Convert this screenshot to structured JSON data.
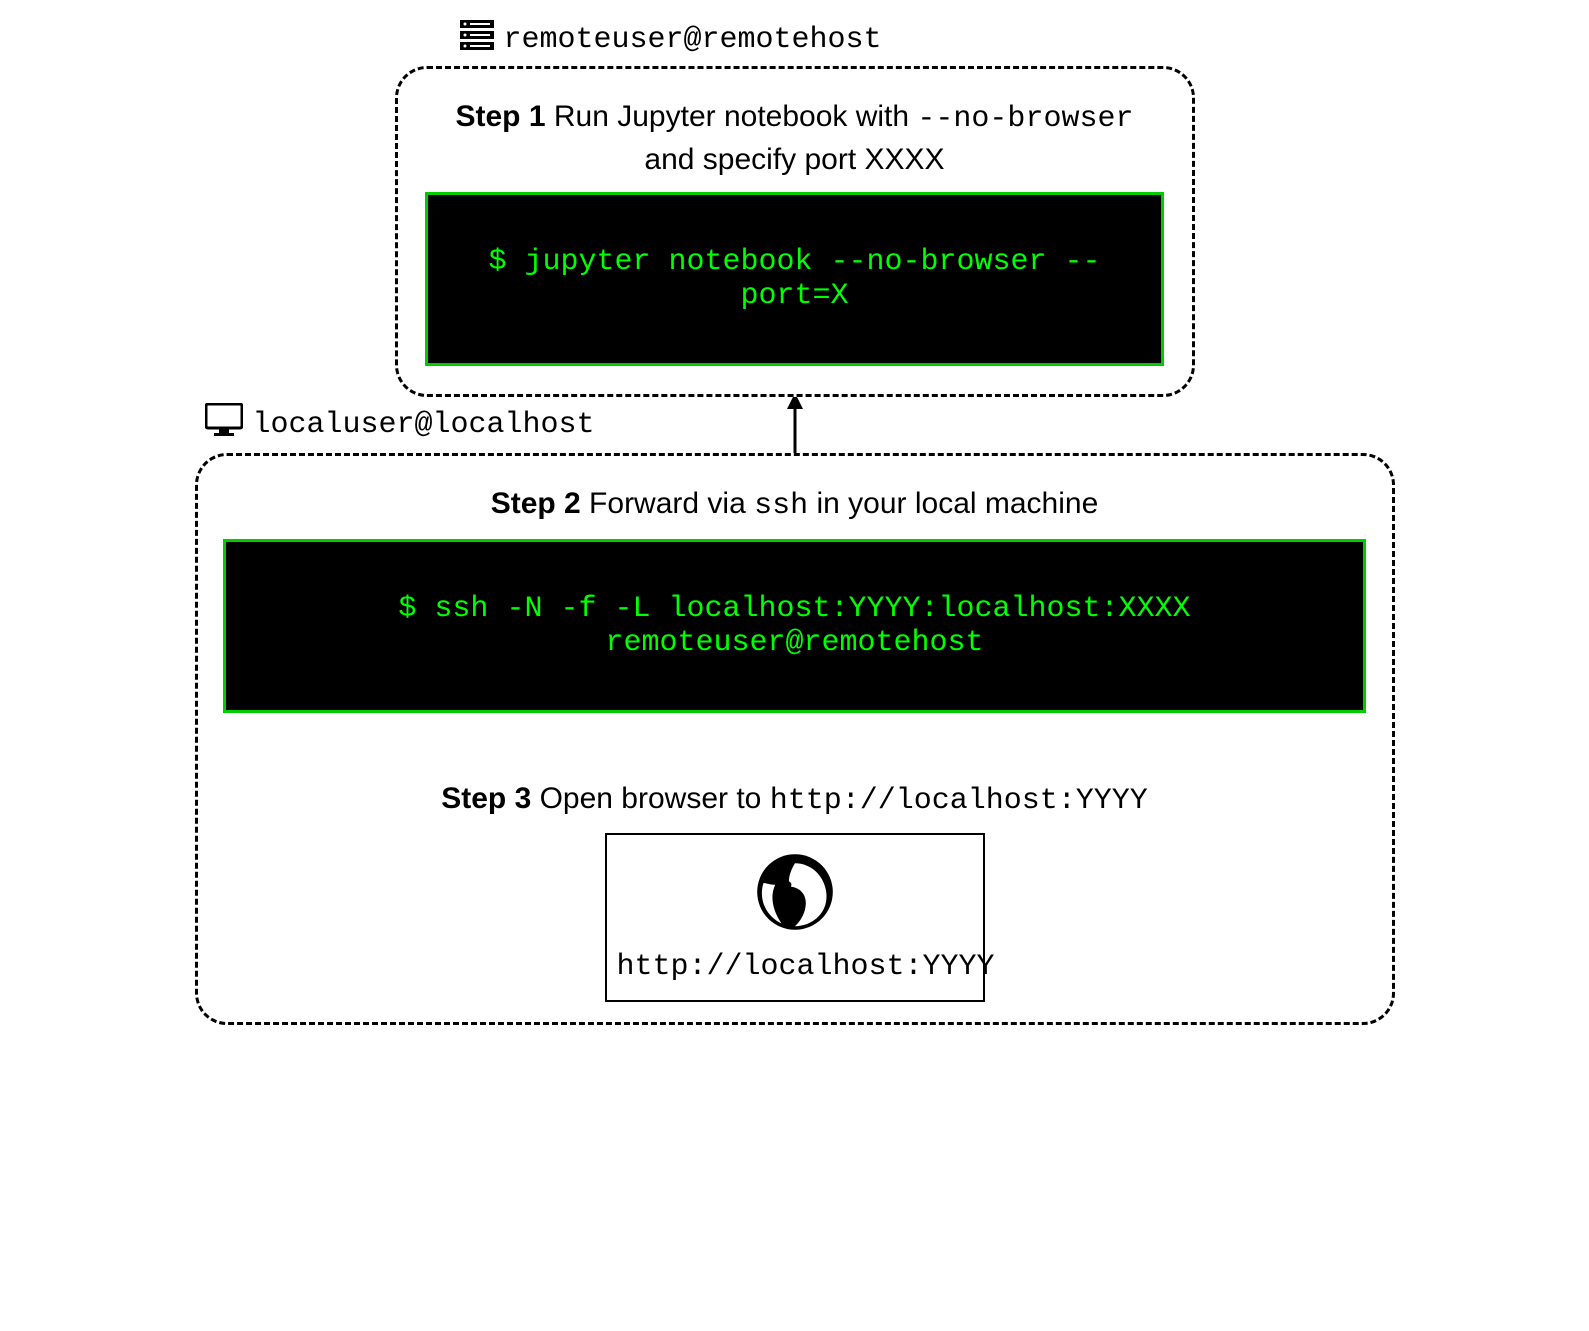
{
  "remote": {
    "host_label": "remoteuser@remotehost",
    "step1": {
      "strong": "Step 1",
      "text_before_tt": " Run Jupyter notebook with ",
      "tt": "--no-browser",
      "text_after_tt": " and specify port XXXX",
      "command": "$ jupyter notebook --no-browser --port=X"
    }
  },
  "local": {
    "host_label": "localuser@localhost",
    "step2": {
      "strong": "Step 2",
      "text_before_tt": " Forward via ",
      "tt": "ssh",
      "text_after_tt": " in your local machine",
      "command": "$ ssh -N -f -L localhost:YYYY:localhost:XXXX remoteuser@remotehost"
    },
    "step3": {
      "strong": "Step 3",
      "text_before_tt": " Open browser to ",
      "tt": "http://localhost:YYYY",
      "browser_url": "http://localhost:YYYY"
    }
  }
}
